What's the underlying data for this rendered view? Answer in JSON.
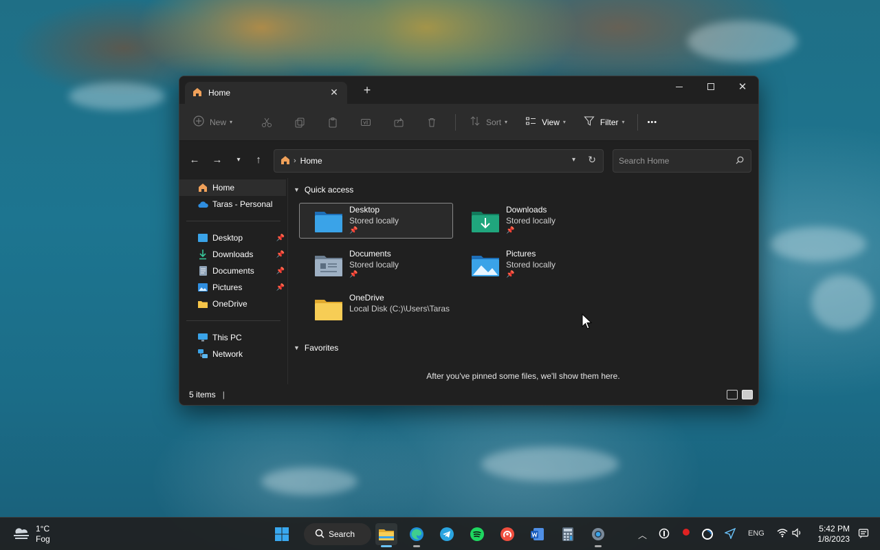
{
  "window": {
    "tab_title": "Home",
    "new_tab_symbol": "+",
    "toolbar": {
      "new_label": "New",
      "sort_label": "Sort",
      "view_label": "View",
      "filter_label": "Filter",
      "more_symbol": "•••"
    },
    "address": {
      "crumb": "Home"
    },
    "search": {
      "placeholder": "Search Home"
    },
    "sidebar": {
      "top_items": [
        {
          "label": "Home"
        },
        {
          "label": "Taras - Personal"
        }
      ],
      "pinned_items": [
        {
          "label": "Desktop"
        },
        {
          "label": "Downloads"
        },
        {
          "label": "Documents"
        },
        {
          "label": "Pictures"
        },
        {
          "label": "OneDrive"
        }
      ],
      "bottom_items": [
        {
          "label": "This PC"
        },
        {
          "label": "Network"
        }
      ]
    },
    "quick_access": {
      "heading": "Quick access",
      "tiles": [
        {
          "name": "Desktop",
          "sub": "Stored locally"
        },
        {
          "name": "Downloads",
          "sub": "Stored locally"
        },
        {
          "name": "Documents",
          "sub": "Stored locally"
        },
        {
          "name": "Pictures",
          "sub": "Stored locally"
        },
        {
          "name": "OneDrive",
          "sub": "Local Disk (C:)\\Users\\Taras"
        }
      ]
    },
    "favorites": {
      "heading": "Favorites",
      "empty_message": "After you've pinned some files, we'll show them here."
    },
    "status": {
      "item_count": "5 items"
    }
  },
  "taskbar": {
    "weather": {
      "temp": "1°C",
      "condition": "Fog"
    },
    "search_label": "Search",
    "language": "ENG",
    "time": "5:42 PM",
    "date": "1/8/2023"
  },
  "colors": {
    "window_bg": "#202020",
    "toolbar_bg": "#2c2c2c",
    "accent": "#6cc6ff"
  }
}
